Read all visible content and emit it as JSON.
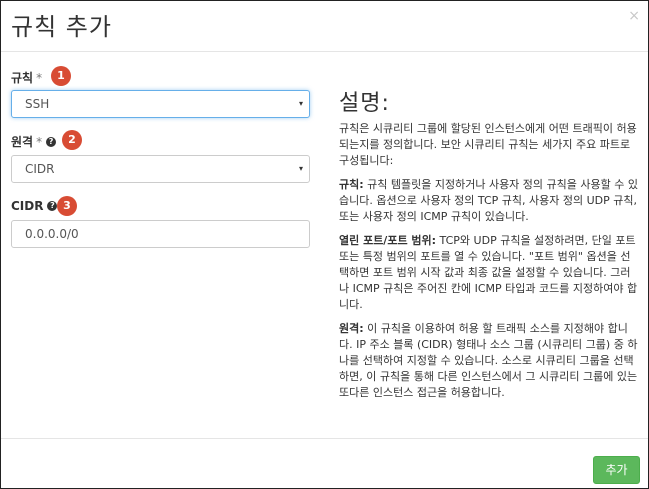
{
  "dialog": {
    "title": "규칙 추가",
    "close_label": "×"
  },
  "form": {
    "rule": {
      "label": "규칙",
      "required_mark": "*",
      "badge": "1",
      "value": "SSH"
    },
    "remote": {
      "label": "원격",
      "required_mark": "*",
      "badge": "2",
      "value": "CIDR"
    },
    "cidr": {
      "label": "CIDR",
      "badge": "3",
      "value": "0.0.0.0/0"
    },
    "help_glyph": "?",
    "caret_glyph": "▾"
  },
  "description": {
    "title": "설명:",
    "intro": "규칙은 시큐리티 그룹에 할당된 인스턴스에게 어떤 트래픽이 허용되는지를 정의합니다. 보안 시큐리티 규칙는 세가지 주요 파트로 구성됩니다:",
    "p1_bold": "규칙:",
    "p1_text": " 규칙 템플릿을 지정하거나 사용자 정의 규칙을 사용할 수 있습니다. 옵션으로 사용자 정의 TCP 규칙, 사용자 정의 UDP 규칙, 또는 사용자 정의 ICMP 규칙이 있습니다.",
    "p2_bold": "열린 포트/포트 범위:",
    "p2_text": " TCP와 UDP 규칙을 설정하려면, 단일 포트 또는 특정 범위의 포트를 열 수 있습니다. \"포트 범위\" 옵션을 선택하면 포트 범위 시작 값과 최종 값을 설정할 수 있습니다. 그러나 ICMP 규칙은 주어진 칸에 ICMP 타입과 코드를 지정하여야 합니다.",
    "p3_bold": "원격:",
    "p3_text": " 이 규칙을 이용하여 허용 할 트래픽 소스를 지정해야 합니다. IP 주소 블록 (CIDR) 형태나 소스 그룹 (시큐리티 그룹) 중 하나를 선택하여 지정할 수 있습니다. 소스로 시큐리티 그룹을 선택하면, 이 규칙을 통해 다른 인스턴스에서 그 시큐리티 그룹에 있는 또다른 인스턴스 접근을 허용합니다."
  },
  "footer": {
    "add_label": "추가"
  },
  "colors": {
    "badge": "#d84c34",
    "primary_button": "#5cb85c",
    "focus_border": "#66afe9"
  }
}
